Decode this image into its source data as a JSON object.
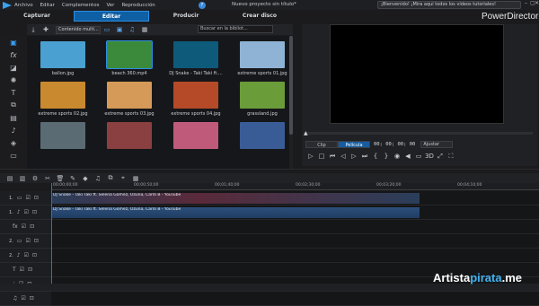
{
  "app": {
    "menu": [
      "Archivo",
      "Editar",
      "Complementos",
      "Ver",
      "Reproducción"
    ],
    "project_title": "Nuevo proyecto sin título*",
    "welcome": "¡Bienvenido! ¡Mira aquí todos los vídeos tutoriales!",
    "brand": "PowerDirector",
    "help": "?",
    "window_buttons": [
      "–",
      "▢",
      "✕"
    ]
  },
  "mode_tabs": [
    "Capturar",
    "Editar",
    "Producir",
    "Crear disco"
  ],
  "active_tab": "Editar",
  "library": {
    "filter_label": "Contenido multi...",
    "search_placeholder": "Buscar en la bibliot...",
    "items": [
      {
        "name": "ballon.jpg",
        "color": "#4aa0d0"
      },
      {
        "name": "beach 360.mp4",
        "color": "#3b8a3b",
        "selected": true
      },
      {
        "name": "DJ Snake - Taki Taki ft....",
        "color": "#0d5a7a"
      },
      {
        "name": "extreme sports 01.jpg",
        "color": "#8fb3d4"
      },
      {
        "name": "extreme sports 02.jpg",
        "color": "#c9892f"
      },
      {
        "name": "extreme sports 03.jpg",
        "color": "#d59a57"
      },
      {
        "name": "extreme sports 04.jpg",
        "color": "#b44a28"
      },
      {
        "name": "grassland.jpg",
        "color": "#6b9c3a"
      },
      {
        "name": "",
        "color": "#5a6b74"
      },
      {
        "name": "",
        "color": "#8a4040"
      },
      {
        "name": "",
        "color": "#c05a7a"
      },
      {
        "name": "",
        "color": "#3a5c96"
      }
    ]
  },
  "preview": {
    "mode_clip": "Clip",
    "mode_movie": "Película",
    "timecode": "00; 00; 00; 00",
    "fit": "Ajustar",
    "threeD": "3D"
  },
  "timeline": {
    "ruler": [
      "00;00;00;00",
      "00;00;50;00",
      "00;01;40;00",
      "00;02;30;00",
      "00;03;20;00",
      "00;04;10;00"
    ],
    "tracks": [
      {
        "label": "1.",
        "type": "video"
      },
      {
        "label": "1.",
        "type": "audio"
      },
      {
        "label": "",
        "type": "fx"
      },
      {
        "label": "2.",
        "type": "video"
      },
      {
        "label": "2.",
        "type": "audio"
      },
      {
        "label": "",
        "type": "title"
      },
      {
        "label": "",
        "type": "voice"
      },
      {
        "label": "",
        "type": "music"
      }
    ],
    "clip_video": "DJ Snake - Taki Taki ft. Selena Gomez, Ozuna, Cardi B - YouTube",
    "clip_audio": "DJ Snake - Taki Taki ft. Selena Gomez, Ozuna, Cardi B - YouTube"
  },
  "watermark": {
    "main": "Artista",
    "accent": "pirata",
    "tld": ".me"
  }
}
